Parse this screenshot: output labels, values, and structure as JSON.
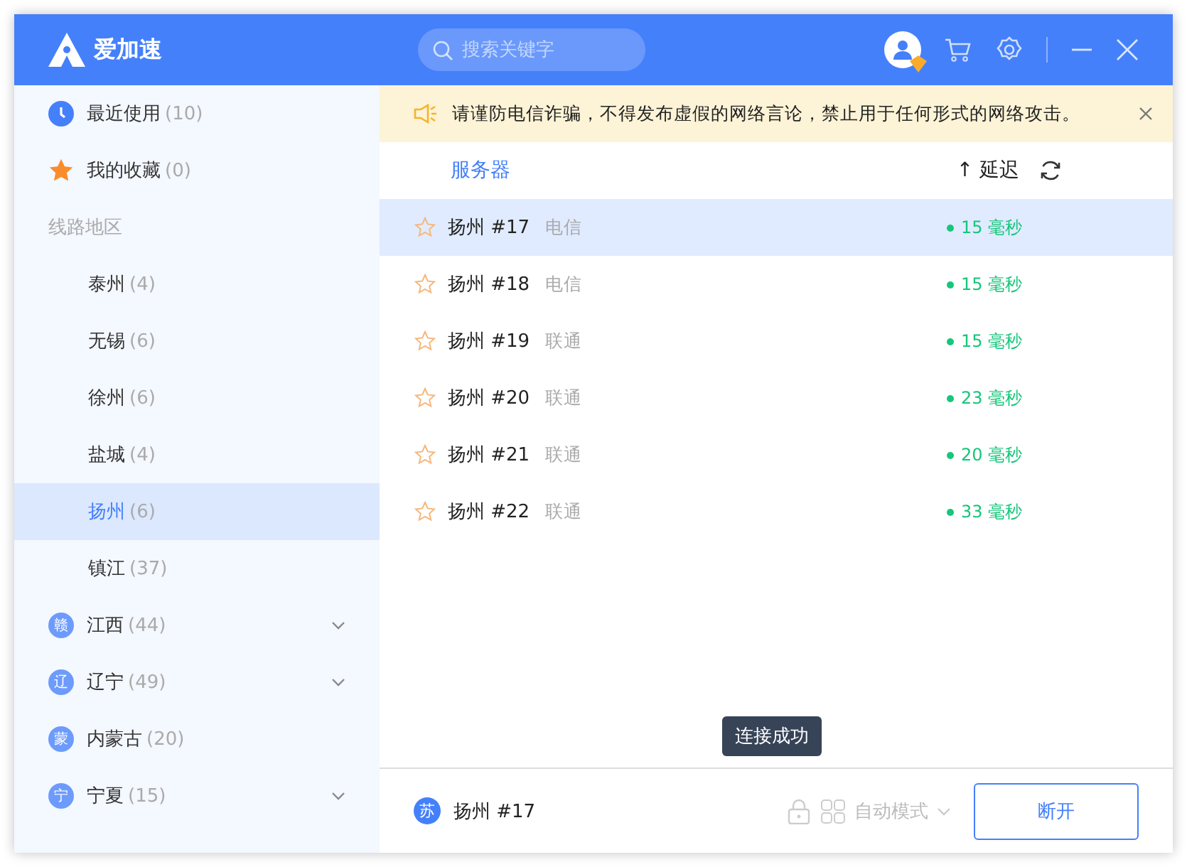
{
  "app": {
    "name": "爱加速"
  },
  "search": {
    "placeholder": "搜索关键字"
  },
  "sidebar": {
    "items": [
      {
        "kind": "recent",
        "label": "最近使用",
        "count": "(10)",
        "selected": false
      },
      {
        "kind": "favorites",
        "label": "我的收藏",
        "count": "(0)",
        "selected": false
      },
      {
        "kind": "section",
        "label": "线路地区"
      },
      {
        "kind": "city",
        "label": "泰州",
        "count": "(4)",
        "selected": false
      },
      {
        "kind": "city",
        "label": "无锡",
        "count": "(6)",
        "selected": false
      },
      {
        "kind": "city",
        "label": "徐州",
        "count": "(6)",
        "selected": false
      },
      {
        "kind": "city",
        "label": "盐城",
        "count": "(4)",
        "selected": false
      },
      {
        "kind": "city",
        "label": "扬州",
        "count": "(6)",
        "selected": true
      },
      {
        "kind": "city",
        "label": "镇江",
        "count": "(37)",
        "selected": false
      },
      {
        "kind": "province",
        "badge": "赣",
        "label": "江西",
        "count": "(44)",
        "expandable": true,
        "selected": false
      },
      {
        "kind": "province",
        "badge": "辽",
        "label": "辽宁",
        "count": "(49)",
        "expandable": true,
        "selected": false
      },
      {
        "kind": "province",
        "badge": "蒙",
        "label": "内蒙古",
        "count": "(20)",
        "expandable": false,
        "selected": false
      },
      {
        "kind": "province",
        "badge": "宁",
        "label": "宁夏",
        "count": "(15)",
        "expandable": true,
        "selected": false
      }
    ]
  },
  "notice": {
    "text": "请谨防电信诈骗，不得发布虚假的网络言论，禁止用于任何形式的网络攻击。"
  },
  "table": {
    "columns": [
      "服务器",
      "↑ 延迟"
    ],
    "rows": [
      {
        "name": "扬州 #17",
        "isp": "电信",
        "latency": "15 毫秒",
        "selected": true
      },
      {
        "name": "扬州 #18",
        "isp": "电信",
        "latency": "15 毫秒",
        "selected": false
      },
      {
        "name": "扬州 #19",
        "isp": "联通",
        "latency": "15 毫秒",
        "selected": false
      },
      {
        "name": "扬州 #20",
        "isp": "联通",
        "latency": "23 毫秒",
        "selected": false
      },
      {
        "name": "扬州 #21",
        "isp": "联通",
        "latency": "20 毫秒",
        "selected": false
      },
      {
        "name": "扬州 #22",
        "isp": "联通",
        "latency": "33 毫秒",
        "selected": false
      }
    ]
  },
  "tooltip": "连接成功",
  "footer": {
    "badge": "苏",
    "server": "扬州 #17",
    "mode": "自动模式",
    "button": "断开"
  }
}
